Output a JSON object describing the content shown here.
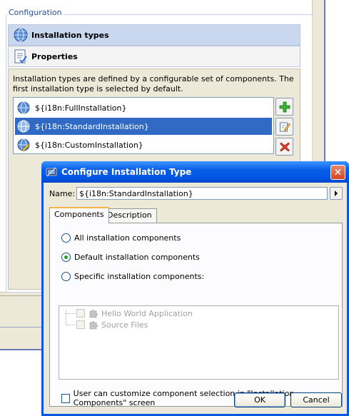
{
  "background": {
    "group_title": "Configuration",
    "nav": [
      {
        "label": "Installation types",
        "icon": "globe-icon",
        "selected": true
      },
      {
        "label": "Properties",
        "icon": "properties-icon",
        "selected": false
      }
    ],
    "description": "Installation types are defined by a configurable set of components. The first installation type is selected by default.",
    "installation_types": [
      {
        "label": "${i18n:FullInstallation}",
        "icon": "globe-icon",
        "selected": false
      },
      {
        "label": "${i18n:StandardInstallation}",
        "icon": "globe-icon",
        "selected": true
      },
      {
        "label": "${i18n:CustomInstallation}",
        "icon": "globe-pencil-icon",
        "selected": false
      }
    ],
    "side_buttons": [
      "add-icon",
      "edit-icon",
      "delete-icon"
    ]
  },
  "dialog": {
    "title": "Configure Installation Type",
    "name_label": "Name:",
    "name_value": "${i18n:StandardInstallation}",
    "tabs": [
      {
        "label": "Components",
        "active": true
      },
      {
        "label": "Description",
        "active": false
      }
    ],
    "radios": [
      {
        "label": "All installation components",
        "checked": false
      },
      {
        "label": "Default installation components",
        "checked": true
      },
      {
        "label": "Specific installation components:",
        "checked": false
      }
    ],
    "components": [
      {
        "label": "Hello World Application",
        "enabled": false
      },
      {
        "label": "Source Files",
        "enabled": false
      }
    ],
    "customize_label": "User can customize component selection in \"Installation Components\" screen",
    "customize_checked": false,
    "ok_label": "OK",
    "cancel_label": "Cancel"
  },
  "colors": {
    "selection": "#316ac5",
    "titlebar": "#0054e3",
    "radio_checked": "#21a121"
  }
}
